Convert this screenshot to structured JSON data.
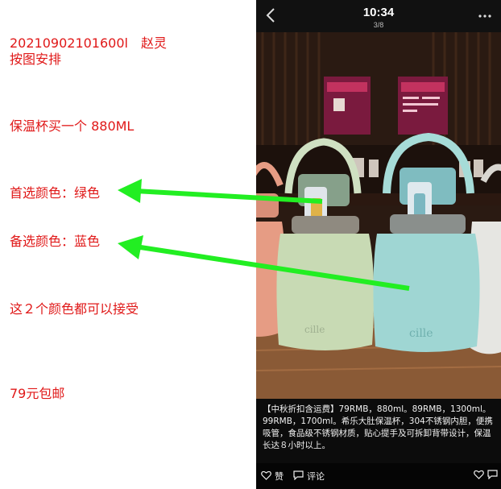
{
  "note": {
    "order_line": "20210902101600l　赵灵",
    "instruction": "按图安排",
    "item": "保温杯买一个 880ML",
    "first_choice": "首选颜色：绿色",
    "second_choice": "备选颜色：蓝色",
    "both_ok": "这２个颜色都可以接受",
    "price": "79元包邮"
  },
  "viewer": {
    "time": "10:34",
    "page": "3/8",
    "caption": "【中秋折扣含运费】79RMB，880ml。89RMB，1300ml。99RMB，1700ml。希乐大肚保温杯，304不锈钢内胆，便携吸管，食品级不锈钢材质，贴心提手及可拆卸背带设计，保温长达８小时以上。",
    "like_label": "赞",
    "comment_label": "评论",
    "bottle_logo": "cille"
  },
  "colors": {
    "note_text": "#e01818",
    "arrow": "#22ee22",
    "green_bottle": "#c8dab4",
    "blue_bottle": "#9fd6d3",
    "pink_bottle": "#e69c84"
  },
  "icons": [
    "back-chevron-icon",
    "more-dots-icon",
    "heart-icon",
    "comment-icon",
    "chat-icon"
  ]
}
